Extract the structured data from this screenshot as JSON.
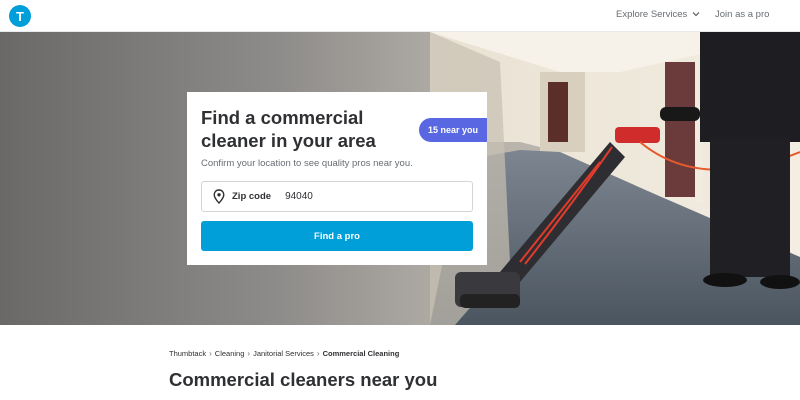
{
  "header": {
    "logo_letter": "T",
    "explore_label": "Explore Services",
    "join_label": "Join as a pro"
  },
  "hero": {
    "title": "Find a commercial cleaner in your area",
    "subtitle": "Confirm your location to see quality pros near you.",
    "badge": "15 near you",
    "zip_label": "Zip code",
    "zip_value": "94040",
    "button_label": "Find a pro"
  },
  "breadcrumb": {
    "items": [
      "Thumbtack",
      "Cleaning",
      "Janitorial Services"
    ],
    "current": "Commercial Cleaning"
  },
  "main": {
    "heading": "Commercial cleaners near you"
  },
  "colors": {
    "brand": "#009fd9",
    "badge": "#5968e2",
    "text": "#2f3033",
    "muted": "#676d73"
  },
  "icons": [
    "thumbtack-logo",
    "chevron-down-icon",
    "location-pin-icon",
    "chevron-right-icon"
  ]
}
